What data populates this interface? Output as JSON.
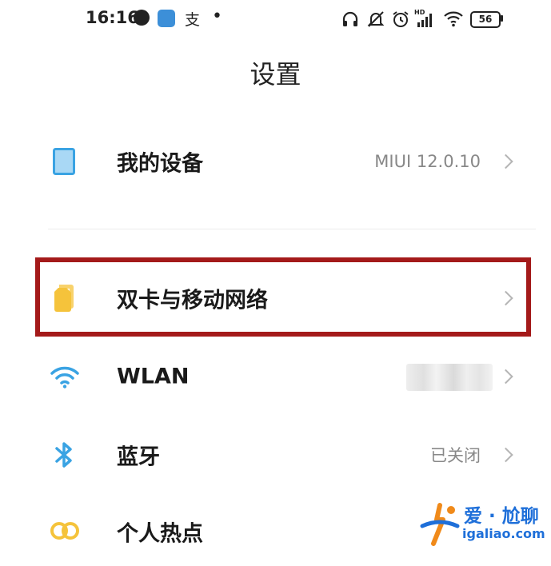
{
  "status_bar": {
    "time": "16:16",
    "app_glyph": "支",
    "battery": "56"
  },
  "page": {
    "title": "设置"
  },
  "rows": [
    {
      "label": "我的设备",
      "value": "MIUI 12.0.10",
      "icon": "device-icon"
    },
    {
      "label": "双卡与移动网络",
      "value": "",
      "icon": "sim-card-icon"
    },
    {
      "label": "WLAN",
      "value": "",
      "icon": "wifi-icon"
    },
    {
      "label": "蓝牙",
      "value": "已关闭",
      "icon": "bluetooth-icon"
    },
    {
      "label": "个人热点",
      "value": "",
      "icon": "hotspot-icon"
    }
  ],
  "watermark": {
    "text": "爱 · 尬聊",
    "url": "igaliao.com"
  },
  "colors": {
    "accent_blue": "#3aa3e3",
    "sim_yellow": "#f5c33b",
    "highlight_red": "#a41a1a"
  }
}
